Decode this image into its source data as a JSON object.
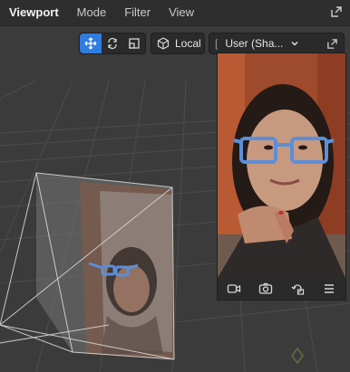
{
  "menu": {
    "items": [
      {
        "label": "Viewport",
        "active": true
      },
      {
        "label": "Mode",
        "active": false
      },
      {
        "label": "Filter",
        "active": false
      },
      {
        "label": "View",
        "active": false
      }
    ]
  },
  "toolbar": {
    "space_label": "Local",
    "camera_label": "User (Sha...",
    "icons": [
      "move-icon",
      "rotate-icon",
      "scale-icon",
      "cube-icon",
      "chevron-down-icon",
      "popout-icon"
    ]
  },
  "camera_panel": {
    "footer_icons": [
      "video-camera-icon",
      "snapshot-icon",
      "rotate-camera-icon",
      "menu-icon"
    ]
  },
  "colors": {
    "accent": "#2f7de0",
    "glasses": "#5b8fd8"
  }
}
